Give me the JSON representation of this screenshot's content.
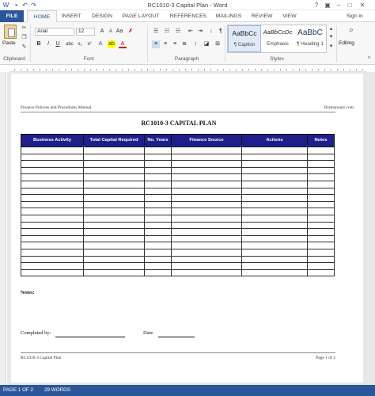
{
  "window": {
    "title": "RC1010-3 Capital Plan - Word"
  },
  "tabs": [
    "FILE",
    "HOME",
    "INSERT",
    "DESIGN",
    "PAGE LAYOUT",
    "REFERENCES",
    "MAILINGS",
    "REVIEW",
    "VIEW"
  ],
  "signin": "Sign in",
  "ribbon": {
    "clipboard": {
      "label": "Clipboard",
      "paste": "Paste"
    },
    "font": {
      "label": "Font",
      "name": "Arial",
      "size": "12"
    },
    "paragraph": {
      "label": "Paragraph"
    },
    "styles": {
      "label": "Styles",
      "items": [
        {
          "sample": "AaBbCc",
          "name": "¶ Caption"
        },
        {
          "sample": "AaBbCcDc",
          "name": "Emphasis"
        },
        {
          "sample": "AaBbC",
          "name": "¶ Heading 1"
        }
      ]
    },
    "editing": {
      "label": "Editing"
    }
  },
  "document": {
    "header_left": "Finance Policies and Procedures Manual",
    "header_right": "Bizmanualz.com",
    "title": "RC1010-3 CAPITAL PLAN",
    "table": {
      "columns": [
        "Business Activity",
        "Total Capital Required",
        "No. Years",
        "Finance Source",
        "Actions",
        "Notes"
      ]
    },
    "notes_label": "Notes:",
    "completed_label": "Completed by:",
    "date_label": "Date",
    "footer_left": "RC1010-3 Capital Plan",
    "footer_right": "Page 1 of 2"
  },
  "statusbar": {
    "page": "PAGE 1 OF 2",
    "words": "29 WORDS"
  }
}
